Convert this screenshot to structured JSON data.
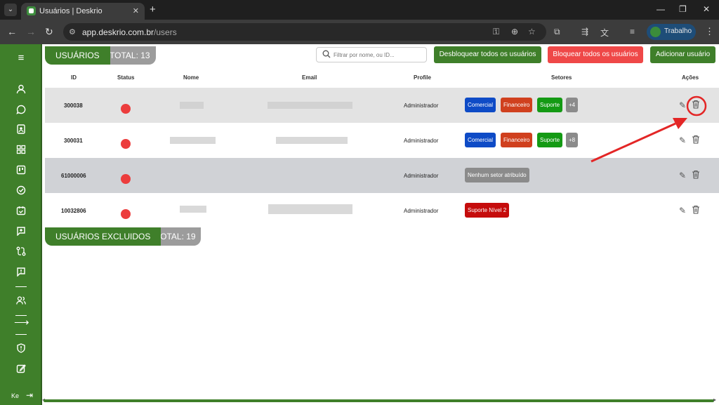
{
  "browser": {
    "tab_title": "Usuários | Deskrio",
    "tab_close": "✕",
    "new_tab": "+",
    "url_host": "app.deskrio.com.br",
    "url_path": "/users",
    "profile_name": "Trabalho",
    "window_controls": [
      "—",
      "❐",
      "✕"
    ]
  },
  "sidebar": {
    "user_initials": "Ke",
    "icons": [
      "menu-icon",
      "person-icon",
      "chat-icon",
      "contact-card-icon",
      "dashboard-icon",
      "kanban-icon",
      "check-circle-icon",
      "calendar-icon",
      "add-message-icon",
      "flow-icon",
      "alert-message-icon",
      "users-icon",
      "arrow-right-icon",
      "shield-icon",
      "edit-icon"
    ]
  },
  "header": {
    "title": "USUÁRIOS",
    "total": "TOTAL: 13",
    "search_placeholder": "Filtrar por nome, ou ID...",
    "unlock_all": "Desbloquear todos os usuários",
    "lock_all": "Bloquear todos os usuários",
    "add_user": "Adicionar usuário"
  },
  "table": {
    "columns": [
      "ID",
      "Status",
      "Nome",
      "Email",
      "Profile",
      "Setores",
      "Ações"
    ],
    "rows": [
      {
        "id": "300038",
        "profile": "Administrador",
        "sectors": [
          "Comercial",
          "Financeiro",
          "Suporte",
          "+4"
        ]
      },
      {
        "id": "300031",
        "profile": "Administrador",
        "sectors": [
          "Comercial",
          "Financeiro",
          "Suporte",
          "+8"
        ]
      },
      {
        "id": "61000006",
        "profile": "Administrador",
        "sectors": [
          "Nenhum setor atribuído"
        ]
      },
      {
        "id": "10032806",
        "profile": "Administrador",
        "sectors": [
          "Suporte Nível 2"
        ]
      }
    ]
  },
  "excluded": {
    "title": "USUÁRIOS EXCLUIDOS",
    "total": "TOTAL: 19"
  },
  "colors": {
    "brand_green": "#3f7f2a",
    "danger_red": "#ef4848",
    "status_red": "#ec3d3d",
    "annotation_red": "#e32626"
  }
}
